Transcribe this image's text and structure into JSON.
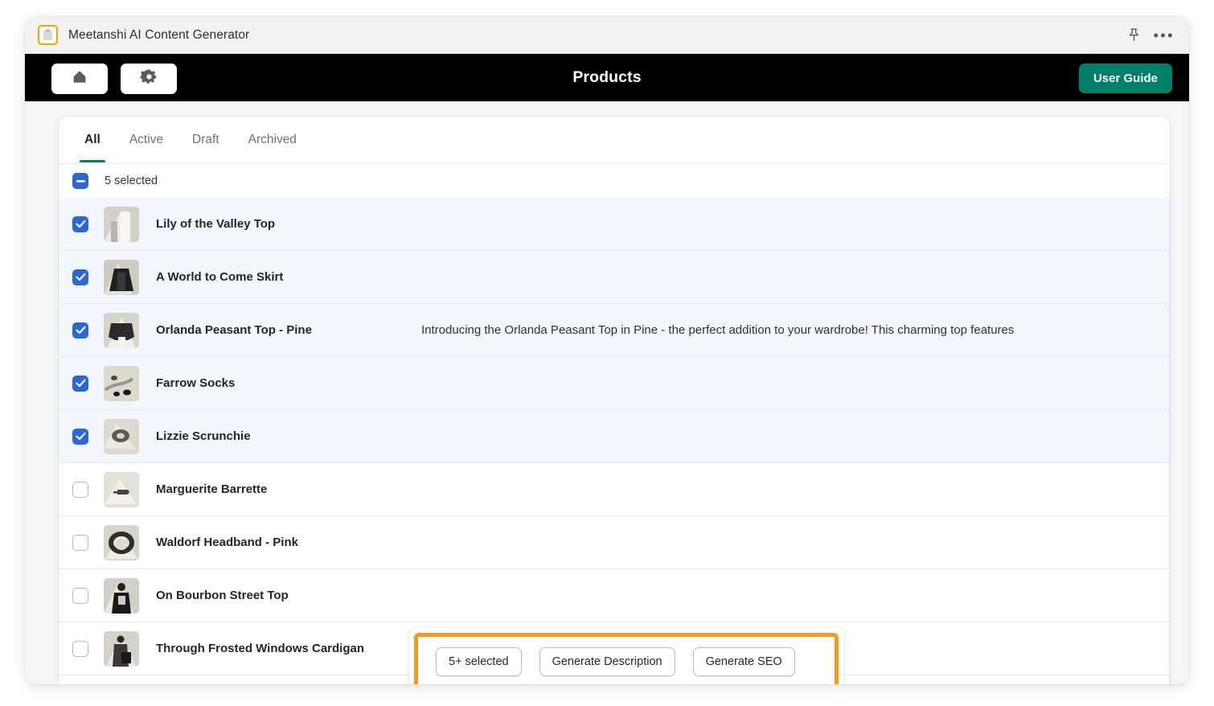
{
  "window": {
    "app_title": "Meetanshi AI Content Generator",
    "app_icon": "clipboard-icon",
    "pin_icon": "pin-icon",
    "more_icon": "more-horizontal-icon",
    "accent_orange": "#F5A300"
  },
  "navbar": {
    "home_icon": "home-icon",
    "settings_icon": "gear-icon",
    "page_title": "Products",
    "user_guide_label": "User Guide",
    "background": "#000000",
    "user_guide_color": "#00806A"
  },
  "tabs": [
    {
      "label": "All",
      "active": true
    },
    {
      "label": "Active",
      "active": false
    },
    {
      "label": "Draft",
      "active": false
    },
    {
      "label": "Archived",
      "active": false
    }
  ],
  "selection": {
    "checkbox_state": "indeterminate",
    "label": "5 selected",
    "checkbox_color": "#2C67D4"
  },
  "products": [
    {
      "title": "Lily of the Valley Top",
      "selected": true,
      "description": ""
    },
    {
      "title": "A World to Come Skirt",
      "selected": true,
      "description": ""
    },
    {
      "title": "Orlanda Peasant Top - Pine",
      "selected": true,
      "description": "Introducing the Orlanda Peasant Top in Pine - the perfect addition to your wardrobe! This charming top features"
    },
    {
      "title": "Farrow Socks",
      "selected": true,
      "description": ""
    },
    {
      "title": "Lizzie Scrunchie",
      "selected": true,
      "description": ""
    },
    {
      "title": "Marguerite Barrette",
      "selected": false,
      "description": ""
    },
    {
      "title": "Waldorf Headband - Pink",
      "selected": false,
      "description": ""
    },
    {
      "title": "On Bourbon Street Top",
      "selected": false,
      "description": ""
    },
    {
      "title": "Through Frosted Windows Cardigan",
      "selected": false,
      "description": ""
    }
  ],
  "bulk_actions": {
    "highlight_color": "#F59A23",
    "selected_count_label": "5+ selected",
    "generate_description_label": "Generate Description",
    "generate_seo_label": "Generate SEO"
  }
}
